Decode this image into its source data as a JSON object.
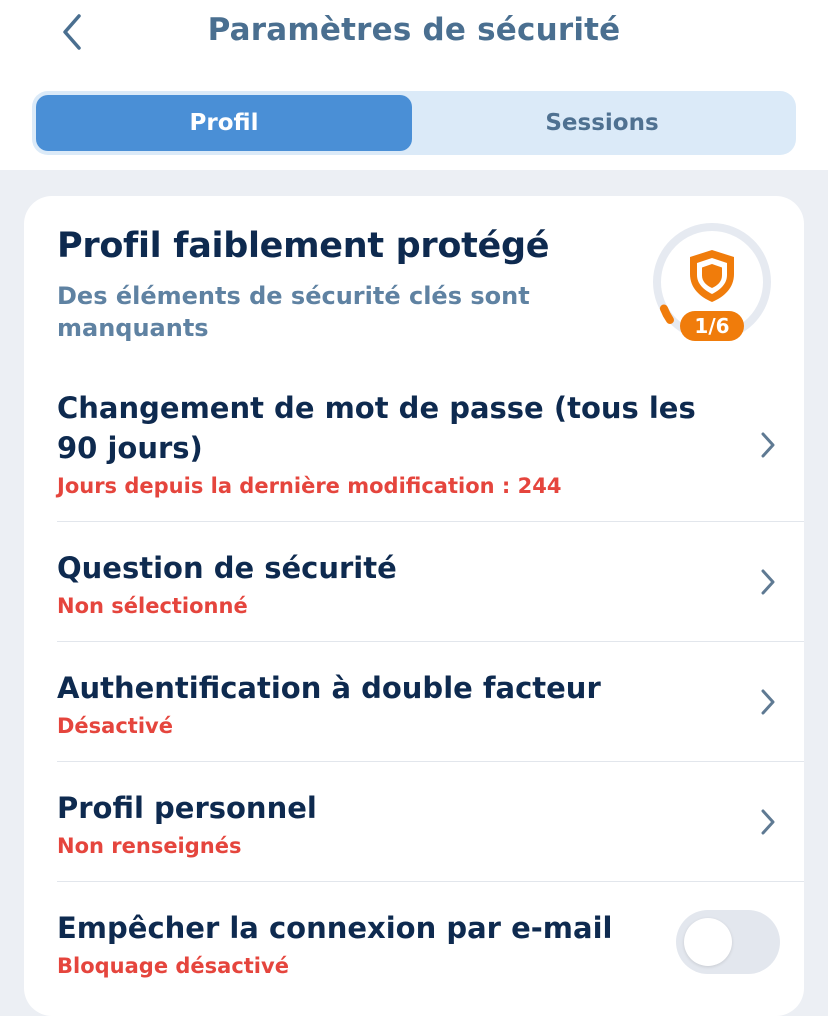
{
  "header": {
    "title": "Paramètres de sécurité",
    "back_icon": "chevron-left-icon"
  },
  "tabs": [
    {
      "label": "Profil",
      "active": true
    },
    {
      "label": "Sessions",
      "active": false
    }
  ],
  "summary": {
    "title": "Profil faiblement protégé",
    "subtitle": "Des éléments de sécurité clés sont manquants",
    "score_label": "1/6",
    "score_value": 1,
    "score_max": 6,
    "score_icon": "shield-icon",
    "accent_color": "#f07c0b"
  },
  "items": [
    {
      "title": "Changement de mot de passe (tous les 90 jours)",
      "status": "Jours depuis la dernière modification : 244",
      "control": "chevron"
    },
    {
      "title": "Question de sécurité",
      "status": "Non sélectionné",
      "control": "chevron"
    },
    {
      "title": "Authentification à double facteur",
      "status": "Désactivé",
      "control": "chevron"
    },
    {
      "title": "Profil personnel",
      "status": "Non renseignés",
      "control": "chevron"
    },
    {
      "title": "Empêcher la connexion par e-mail",
      "status": "Bloquage désactivé",
      "control": "toggle",
      "toggle_on": false
    }
  ],
  "colors": {
    "primary": "#4a8fd6",
    "title_text": "#0e2a4f",
    "warning_text": "#e5453d"
  }
}
